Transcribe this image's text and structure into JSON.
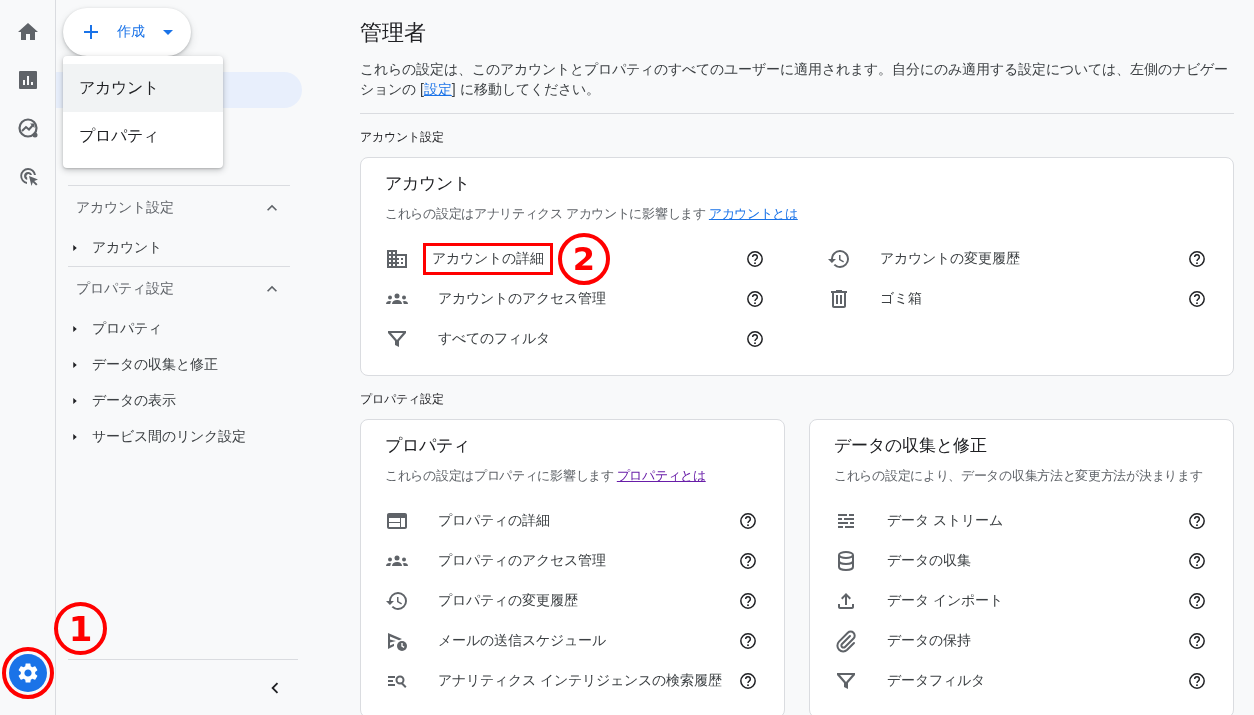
{
  "rail": {
    "items": [
      {
        "kind": "home",
        "selected": false
      },
      {
        "kind": "reports",
        "selected": false
      },
      {
        "kind": "explore",
        "selected": false
      },
      {
        "kind": "advertising",
        "selected": false
      }
    ],
    "settings": {
      "selected": true,
      "highlighted": true,
      "callout": "1"
    }
  },
  "sidebar": {
    "create_button": {
      "label": "作成"
    },
    "create_menu": [
      {
        "label": "アカウント",
        "selected": true
      },
      {
        "label": "プロパティ",
        "selected": false
      }
    ],
    "sections": [
      {
        "title": "アカウント設定",
        "expanded": true,
        "children": [
          {
            "label": "アカウント",
            "expanded": false
          }
        ]
      },
      {
        "title": "プロパティ設定",
        "expanded": true,
        "children": [
          {
            "label": "プロパティ",
            "expanded": false
          },
          {
            "label": "データの収集と修正",
            "expanded": false
          },
          {
            "label": "データの表示",
            "expanded": false
          },
          {
            "label": "サービス間のリンク設定",
            "expanded": false
          }
        ]
      }
    ]
  },
  "page": {
    "title": "管理者",
    "description": {
      "before": "これらの設定は、このアカウントとプロパティのすべてのユーザーに適用されます。自分にのみ適用する設定については、左側のナビゲーションの [",
      "link": "設定",
      "after": "] に移動してください。"
    }
  },
  "sections": [
    {
      "label": "アカウント設定",
      "cards": [
        {
          "title": "アカウント",
          "description": "これらの設定はアナリティクス アカウントに影響します",
          "link": {
            "label": "アカウントとは",
            "visited": false
          },
          "items": [
            {
              "kind": "building",
              "label": "アカウントの詳細",
              "highlighted": true,
              "callout": "2"
            },
            {
              "kind": "history",
              "label": "アカウントの変更履歴",
              "highlighted": false
            },
            {
              "kind": "people",
              "label": "アカウントのアクセス管理",
              "highlighted": false
            },
            {
              "kind": "trash",
              "label": "ゴミ箱",
              "highlighted": false
            },
            {
              "kind": "filter",
              "label": "すべてのフィルタ",
              "highlighted": false
            }
          ]
        }
      ]
    },
    {
      "label": "プロパティ設定",
      "cards": [
        {
          "title": "プロパティ",
          "description": "これらの設定はプロパティに影響します",
          "link": {
            "label": "プロパティとは",
            "visited": true
          },
          "items": [
            {
              "kind": "web",
              "label": "プロパティの詳細",
              "highlighted": false
            },
            {
              "kind": "people",
              "label": "プロパティのアクセス管理",
              "highlighted": false
            },
            {
              "kind": "history",
              "label": "プロパティの変更履歴",
              "highlighted": false
            },
            {
              "kind": "schedule-send",
              "label": "メールの送信スケジュール",
              "highlighted": false
            },
            {
              "kind": "search-list",
              "label": "アナリティクス インテリジェンスの検索履歴",
              "highlighted": false
            }
          ]
        },
        {
          "title": "データの収集と修正",
          "description": "これらの設定により、データの収集方法と変更方法が決まります",
          "items": [
            {
              "kind": "stream",
              "label": "データ ストリーム",
              "highlighted": false
            },
            {
              "kind": "database",
              "label": "データの収集",
              "highlighted": false
            },
            {
              "kind": "upload",
              "label": "データ インポート",
              "highlighted": false
            },
            {
              "kind": "attach",
              "label": "データの保持",
              "highlighted": false
            },
            {
              "kind": "filter",
              "label": "データフィルタ",
              "highlighted": false
            }
          ]
        }
      ]
    }
  ]
}
